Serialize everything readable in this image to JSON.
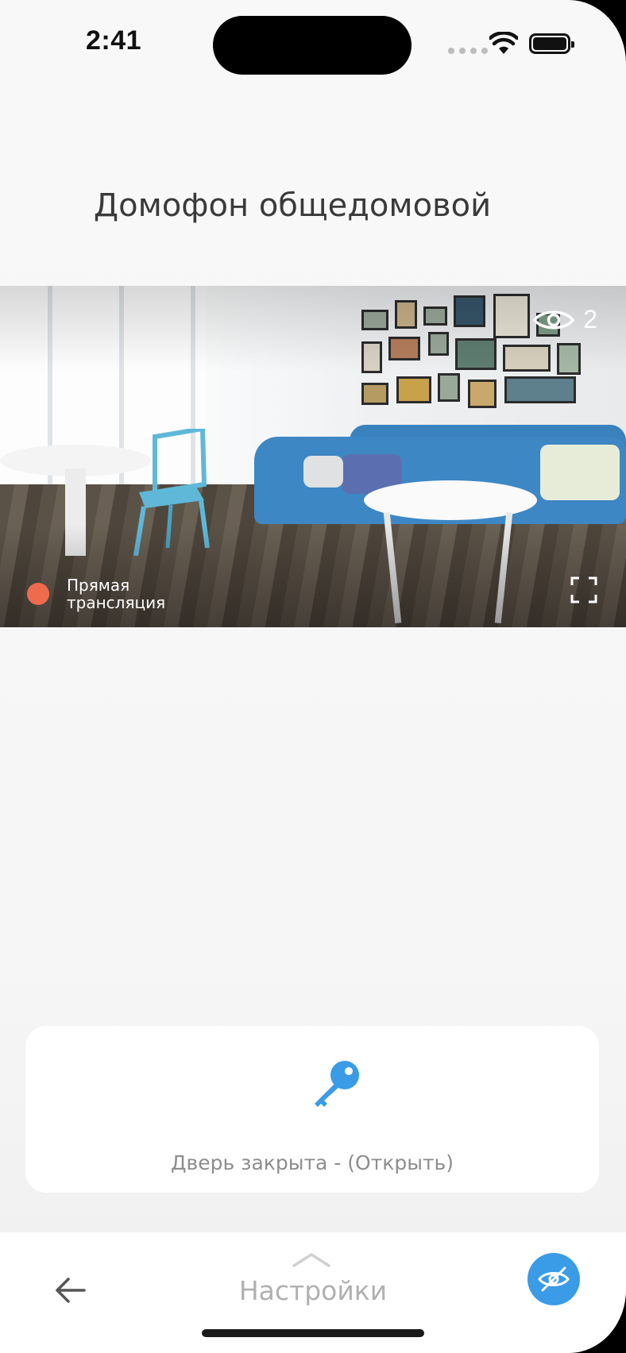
{
  "status_bar": {
    "time": "2:41",
    "wifi_icon": "wifi-icon",
    "battery_icon": "battery-icon"
  },
  "header": {
    "title": "Домофон общедомовой"
  },
  "camera": {
    "viewers_icon": "eye-icon",
    "viewers_count": "2",
    "live_label": "Прямая\nтрансляция",
    "live_color": "#ef6b4e",
    "fullscreen_icon": "fullscreen-icon"
  },
  "door": {
    "icon": "key-icon",
    "icon_color": "#3a9be6",
    "label": "Дверь закрыта - (Открыть)"
  },
  "bottom_bar": {
    "back_icon": "arrow-left-icon",
    "chevron_icon": "chevron-up-icon",
    "settings_label": "Настройки",
    "privacy_icon": "eye-off-icon",
    "accent": "#3a9be6"
  }
}
